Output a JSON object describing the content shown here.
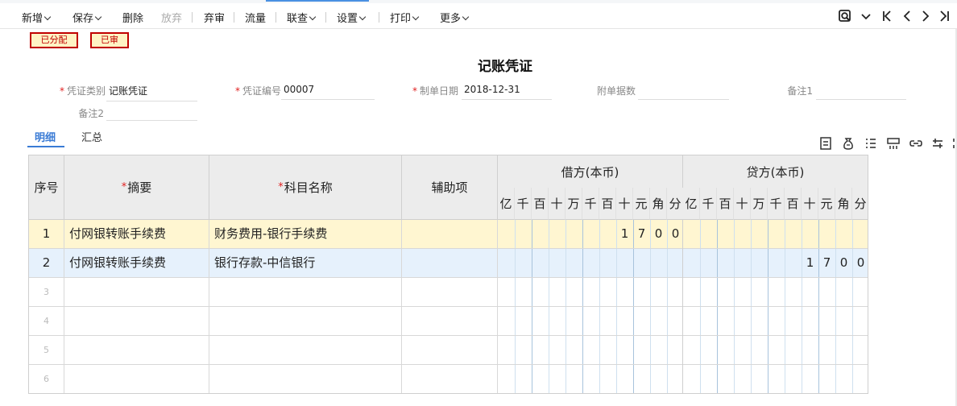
{
  "toolbar": {
    "items": [
      {
        "label": "新增",
        "has_caret": true,
        "disabled": false
      },
      {
        "label": "保存",
        "has_caret": true,
        "disabled": false
      },
      {
        "label": "删除",
        "has_caret": false,
        "disabled": false
      },
      {
        "label": "放弃",
        "has_caret": false,
        "disabled": true
      },
      {
        "label": "弃审",
        "has_caret": false,
        "disabled": false
      },
      {
        "label": "流量",
        "has_caret": false,
        "disabled": false
      },
      {
        "label": "联查",
        "has_caret": true,
        "disabled": false
      },
      {
        "label": "设置",
        "has_caret": true,
        "disabled": false
      },
      {
        "label": "打印",
        "has_caret": true,
        "disabled": false
      },
      {
        "label": "更多",
        "has_caret": true,
        "disabled": false
      }
    ],
    "right_icons": [
      "find-icon",
      "chevron-down-icon",
      "first-page-icon",
      "prev-icon",
      "next-icon",
      "last-page-icon"
    ]
  },
  "stamps": [
    "已分配",
    "已审"
  ],
  "doc": {
    "title": "记账凭证",
    "fields": {
      "type_label": "凭证类别",
      "type_value": "记账凭证",
      "number_label": "凭证编号",
      "number_value": "00007",
      "date_label": "制单日期",
      "date_value": "2018-12-31",
      "attach_label": "附单据数",
      "attach_value": "",
      "note1_label": "备注1",
      "note1_value": "",
      "note2_label": "备注2",
      "note2_value": ""
    }
  },
  "tabs": [
    "明细",
    "汇总"
  ],
  "table_icons": [
    "insert-row-icon",
    "money-bag-icon",
    "list-icon",
    "split-icon",
    "link-icon",
    "swap-icon",
    "more-icon"
  ],
  "table": {
    "headers": {
      "seq": "序号",
      "summary": "摘要",
      "account": "科目名称",
      "aux": "辅助项",
      "debit": "借方(本币)",
      "credit": "贷方(本币)",
      "digits": [
        "亿",
        "千",
        "百",
        "十",
        "万",
        "千",
        "百",
        "十",
        "元",
        "角",
        "分"
      ]
    },
    "rows": [
      {
        "seq": "1",
        "summary": "付网银转账手续费",
        "account": "财务费用-银行手续费",
        "aux": "",
        "debit": "1700",
        "credit": ""
      },
      {
        "seq": "2",
        "summary": "付网银转账手续费",
        "account": "银行存款-中信银行",
        "aux": "",
        "debit": "",
        "credit": "1700"
      },
      {
        "seq": "3",
        "summary": "",
        "account": "",
        "aux": "",
        "debit": "",
        "credit": ""
      },
      {
        "seq": "4",
        "summary": "",
        "account": "",
        "aux": "",
        "debit": "",
        "credit": ""
      },
      {
        "seq": "5",
        "summary": "",
        "account": "",
        "aux": "",
        "debit": "",
        "credit": ""
      },
      {
        "seq": "6",
        "summary": "",
        "account": "",
        "aux": "",
        "debit": "",
        "credit": ""
      }
    ]
  },
  "colors": {
    "accent": "#3a7bd5",
    "stamp_red": "#c00000",
    "stamp_bg": "#fff3c4",
    "selected_row": "#fff6d1",
    "highlight_row": "#e6f1fc"
  }
}
